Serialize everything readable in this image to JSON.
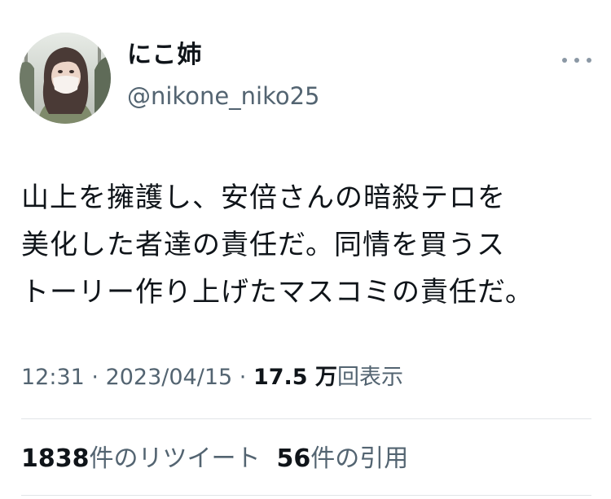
{
  "user": {
    "display_name": "にこ姉",
    "handle": "@nikone_niko25"
  },
  "tweet": {
    "lines": [
      "山上を擁護し、安倍さんの暗殺テロを",
      "美化した者達の責任だ。同情を買うス",
      "トーリー作り上げたマスコミの責任だ。"
    ]
  },
  "meta": {
    "time": "12:31",
    "separator_1": " · ",
    "date": "2023/04/15",
    "separator_2": " · ",
    "views_count": "17.5 万",
    "views_label": "回表示"
  },
  "stats": {
    "retweets_count": "1838",
    "retweets_label": "件のリツイート",
    "quotes_count": "56",
    "quotes_label": "件の引用"
  },
  "icons": {
    "more": "more-horizontal-icon",
    "avatar": "profile-photo"
  },
  "colors": {
    "text_primary": "#0f1419",
    "text_secondary": "#536471",
    "divider": "#e1e5e8"
  }
}
